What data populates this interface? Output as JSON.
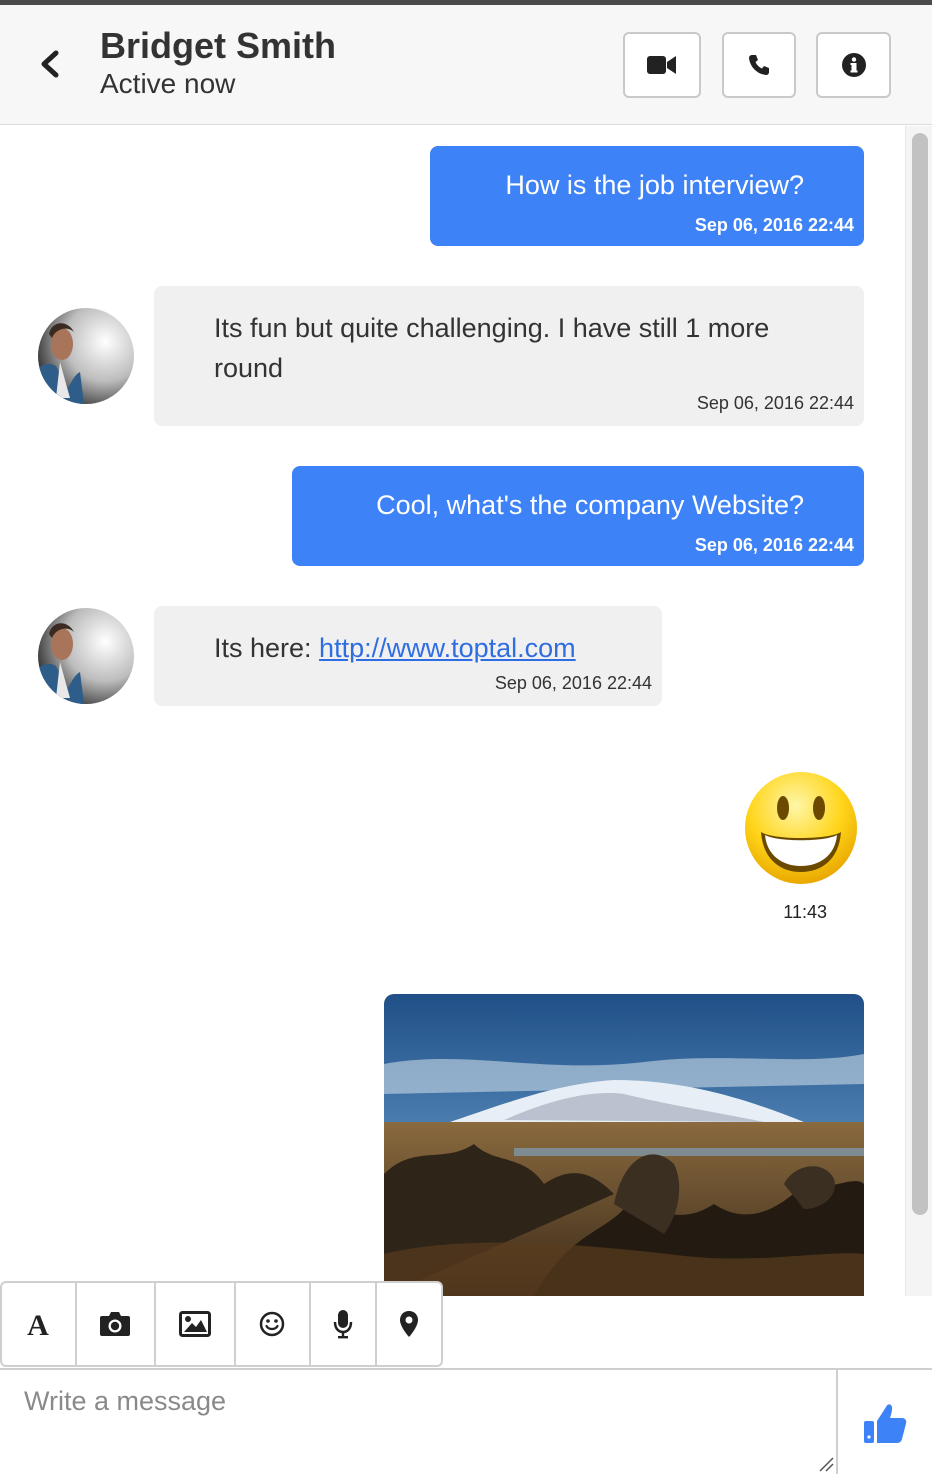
{
  "header": {
    "contact_name": "Bridget Smith",
    "status": "Active now",
    "icons": [
      "chevron-left-icon",
      "video-camera-icon",
      "phone-icon",
      "info-icon"
    ]
  },
  "messages": [
    {
      "direction": "outgoing",
      "text": "How is the job interview?",
      "time": "Sep 06, 2016 22:44"
    },
    {
      "direction": "incoming",
      "text": "Its fun but quite challenging. I have still 1 more round",
      "time": "Sep 06, 2016 22:44"
    },
    {
      "direction": "outgoing",
      "text": "Cool, what's the company Website?",
      "time": "Sep 06, 2016 22:44"
    },
    {
      "direction": "incoming",
      "text_prefix": "Its here: ",
      "link": "http://www.toptal.com",
      "time": "Sep 06, 2016 22:44"
    },
    {
      "direction": "outgoing",
      "type": "emoji",
      "emoji": "grinning-face",
      "time": "11:43"
    },
    {
      "direction": "outgoing",
      "type": "image",
      "image": "snowy-mountain-landscape-photo"
    }
  ],
  "toolbar": {
    "tools": [
      "text-format-icon",
      "camera-icon",
      "image-icon",
      "emoji-icon",
      "microphone-icon",
      "location-pin-icon"
    ]
  },
  "composer": {
    "placeholder": "Write a message",
    "value": "",
    "send_icon": "thumbs-up-icon"
  },
  "colors": {
    "outgoing_bubble": "#3d82f7",
    "incoming_bubble": "#f0f0f0",
    "link": "#2f6ee0",
    "like": "#3d82f7"
  }
}
